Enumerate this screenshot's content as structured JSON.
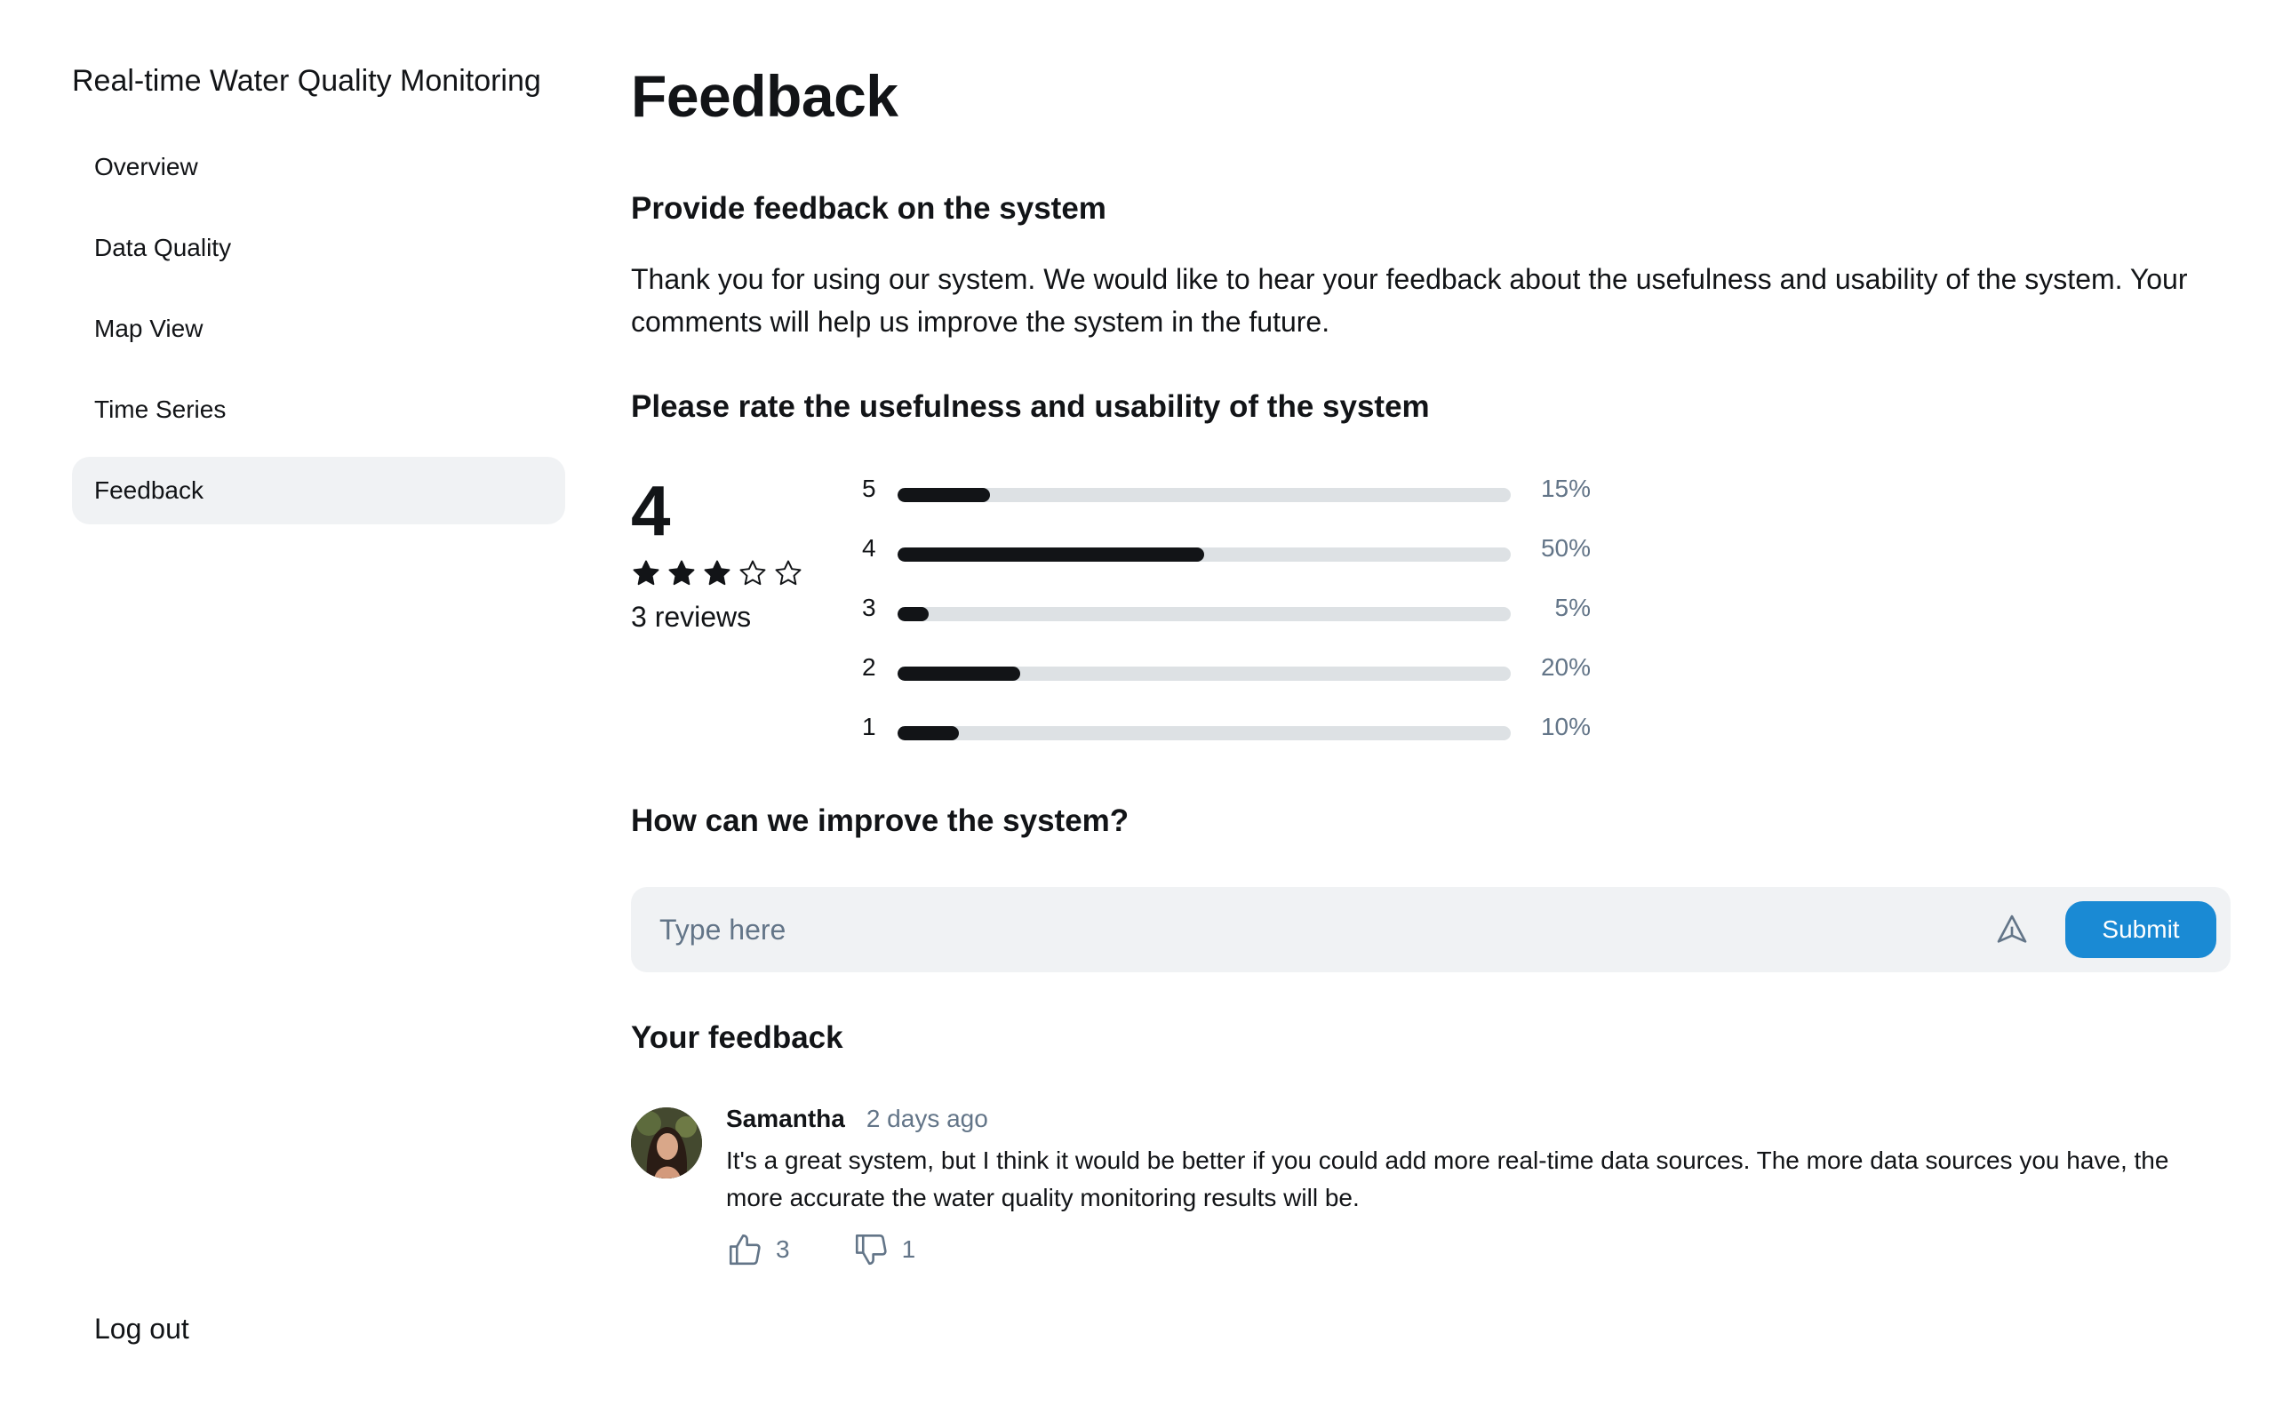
{
  "app": {
    "title": "Real-time Water Quality Monitoring"
  },
  "sidebar": {
    "items": [
      {
        "label": "Overview",
        "active": false
      },
      {
        "label": "Data Quality",
        "active": false
      },
      {
        "label": "Map View",
        "active": false
      },
      {
        "label": "Time Series",
        "active": false
      },
      {
        "label": "Feedback",
        "active": true
      }
    ],
    "logout_label": "Log out"
  },
  "main": {
    "title": "Feedback",
    "provide_heading": "Provide feedback on the system",
    "intro_text": "Thank you for using our system. We would like to hear your feedback about the usefulness and usability of the system. Your comments will help us improve the system in the future.",
    "rate_heading": "Please rate the usefulness and usability of the system",
    "rating": {
      "average": "4",
      "stars_filled": 3,
      "stars_total": 5,
      "reviews_text": "3 reviews",
      "breakdown": [
        {
          "label": "5",
          "percent": 15,
          "percent_text": "15%"
        },
        {
          "label": "4",
          "percent": 50,
          "percent_text": "50%"
        },
        {
          "label": "3",
          "percent": 5,
          "percent_text": "5%"
        },
        {
          "label": "2",
          "percent": 20,
          "percent_text": "20%"
        },
        {
          "label": "1",
          "percent": 10,
          "percent_text": "10%"
        }
      ]
    },
    "improve_heading": "How can we improve the system?",
    "input": {
      "placeholder": "Type here",
      "value": "",
      "submit_label": "Submit"
    },
    "your_feedback_heading": "Your feedback",
    "comments": [
      {
        "author": "Samantha",
        "time": "2 days ago",
        "text": "It's a great system, but I think it would be better if you could add more real-time data sources. The more data sources you have, the more accurate the water quality monitoring results will be.",
        "likes": "3",
        "dislikes": "1"
      }
    ]
  },
  "colors": {
    "text": "#121417",
    "muted": "#637588",
    "active_bg": "#f0f2f4",
    "bar_track": "#dde1e4",
    "accent": "#1a8ad4"
  },
  "icons": {
    "star_filled": "star-filled-icon",
    "star_empty": "star-outline-icon",
    "send": "send-icon",
    "like": "thumbs-up-icon",
    "dislike": "thumbs-down-icon"
  }
}
